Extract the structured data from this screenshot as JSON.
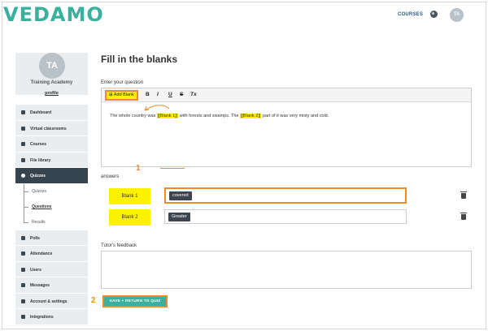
{
  "header": {
    "logo": "VEDAMO",
    "nav_courses": "COURSES",
    "avatar_initials": "TA"
  },
  "sidebar": {
    "avatar_initials": "TA",
    "org_name": "Training Academy",
    "profile_link": "profile",
    "items": [
      {
        "label": "Dashboard",
        "icon": "dashboard-icon"
      },
      {
        "label": "Virtual classrooms",
        "icon": "classroom-icon"
      },
      {
        "label": "Courses",
        "icon": "courses-icon"
      },
      {
        "label": "File library",
        "icon": "file-library-icon"
      },
      {
        "label": "Quizzes",
        "icon": "quizzes-icon",
        "active": true
      },
      {
        "label": "Polls",
        "icon": "polls-icon"
      },
      {
        "label": "Attendance",
        "icon": "attendance-icon"
      },
      {
        "label": "Users",
        "icon": "users-icon"
      },
      {
        "label": "Messages",
        "icon": "messages-icon"
      },
      {
        "label": "Account & settings",
        "icon": "settings-icon"
      },
      {
        "label": "Integrations",
        "icon": "integrations-icon"
      }
    ],
    "subitems": [
      {
        "label": "Quizzes"
      },
      {
        "label": "Questions",
        "current": true
      },
      {
        "label": "Results"
      }
    ]
  },
  "main": {
    "title": "Fill in the blanks",
    "question_label": "Enter your question",
    "toolbar": {
      "add_blank": "Add Blank",
      "bold": "B",
      "italic": "I",
      "underline": "U",
      "strike": "S",
      "clear": "Tx"
    },
    "question_text": {
      "part1": "The whole country was ",
      "blank1": "[[Blank 1]]",
      "part2": " with forests and swamps. The ",
      "blank2": "[[Blank 2]]",
      "part3": " part of it was very misty and cold."
    },
    "annotation_1": "1",
    "answers_label": "answers",
    "answers": [
      {
        "label": "Blank 1",
        "value": "covered"
      },
      {
        "label": "Blank 2",
        "value": "Greater"
      }
    ],
    "feedback_label": "Tutor's feedback",
    "annotation_2": "2",
    "save_button": "SAVE + RETURN TO QUIZ"
  },
  "colors": {
    "brand": "#3ab09e",
    "highlight": "#fff100",
    "annotation": "#f08a24",
    "active_menu": "#36444f"
  }
}
